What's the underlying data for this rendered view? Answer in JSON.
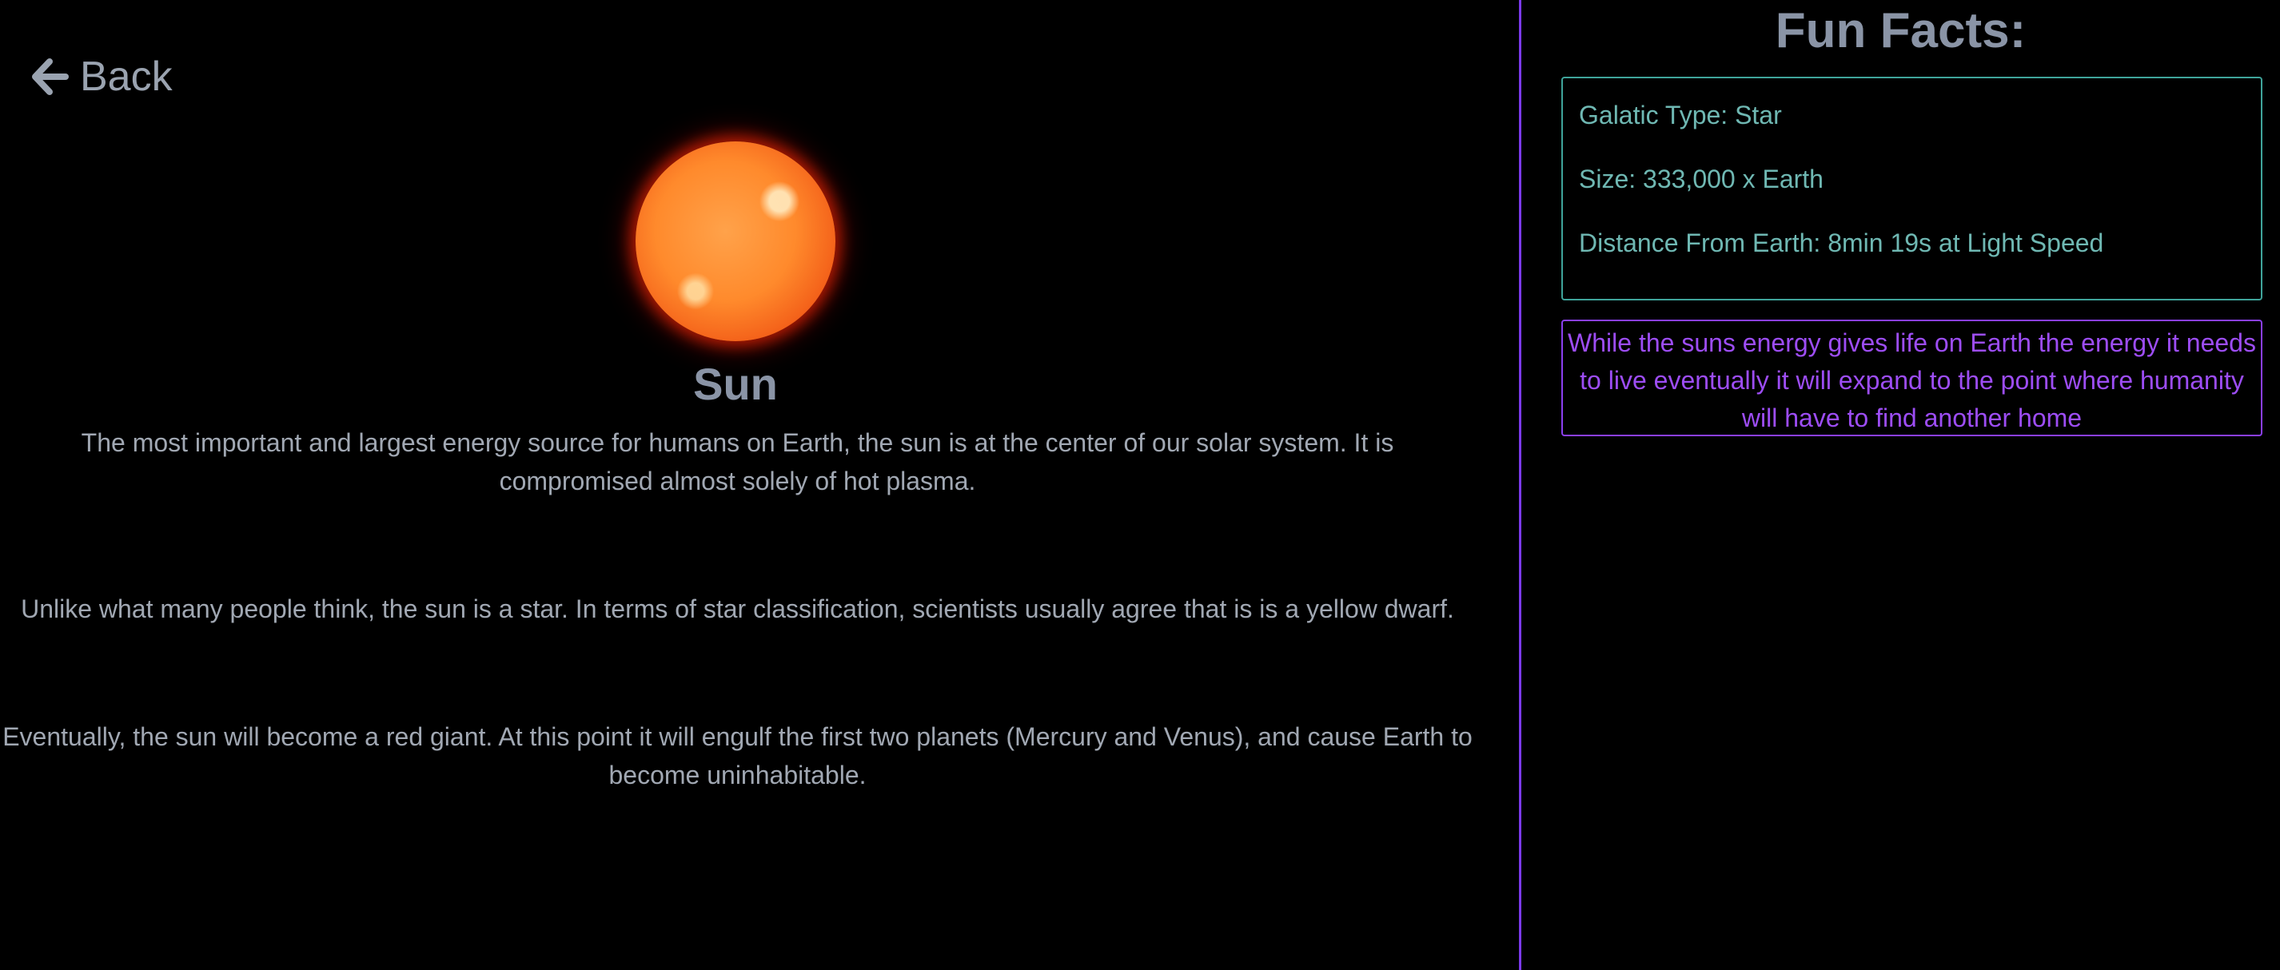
{
  "nav": {
    "back_label": "Back",
    "back_icon": "arrow-left-icon"
  },
  "planet": {
    "image": "sun-image",
    "name": "Sun",
    "paragraphs": [
      "The most important and largest energy source for humans on Earth, the sun is at the center of our solar system. It is compromised almost solely of hot plasma.",
      "Unlike what many people think, the sun is a star. In terms of star classification, scientists usually agree that is is a yellow dwarf.",
      "Eventually, the sun will become a red giant. At this point it will engulf the first two planets (Mercury and Venus), and cause Earth to become uninhabitable."
    ]
  },
  "fun_facts": {
    "title": "Fun Facts:",
    "items": [
      "Galatic Type: Star",
      "Size: 333,000 x Earth",
      "Distance From Earth: 8min 19s at Light Speed"
    ],
    "warning": "While the suns energy gives life on Earth the energy it needs to live eventually it will expand to the point where humanity will have to find another home"
  },
  "colors": {
    "background": "#000000",
    "divider": "#7c3aed",
    "heading": "#8a94a6",
    "text": "#a1a8b3",
    "facts_border": "#3fa39a",
    "facts_text": "#6fb8b3",
    "warning": "#9d4df5"
  }
}
